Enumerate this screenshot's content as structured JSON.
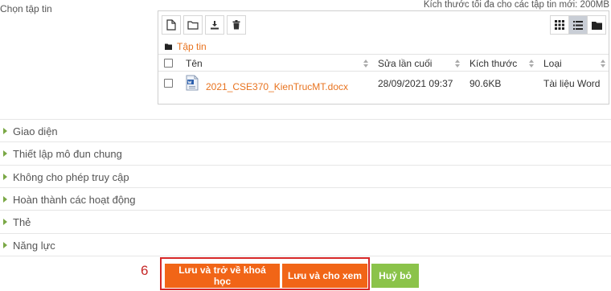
{
  "form": {
    "choose_files_label": "Chọn tập tin",
    "max_size_text": "Kích thước tối đa cho các tập tin mới: 200MB"
  },
  "filepicker": {
    "breadcrumb": "Tập tin",
    "columns": {
      "name": "Tên",
      "modified": "Sửa lần cuối",
      "size": "Kích thước",
      "type": "Loại"
    },
    "files": [
      {
        "name": "2021_CSE370_KienTrucMT.docx",
        "modified": "28/09/2021 09:37",
        "size": "90.6KB",
        "type": "Tài liệu Word"
      }
    ]
  },
  "sections": [
    "Giao diện",
    "Thiết lập mô đun chung",
    "Không cho phép truy cập",
    "Hoàn thành các hoạt động",
    "Thẻ",
    "Năng lực"
  ],
  "annotation": {
    "step_number": "6"
  },
  "buttons": {
    "save_return": "Lưu và trở về khoá học",
    "save_display": "Lưu và cho xem",
    "cancel": "Huỷ bỏ"
  },
  "colors": {
    "accent_orange": "#f16517",
    "link_orange": "#e8731f",
    "cancel_green": "#8bc34a",
    "highlight_red": "#d62828",
    "section_arrow_green": "#7aa845"
  }
}
